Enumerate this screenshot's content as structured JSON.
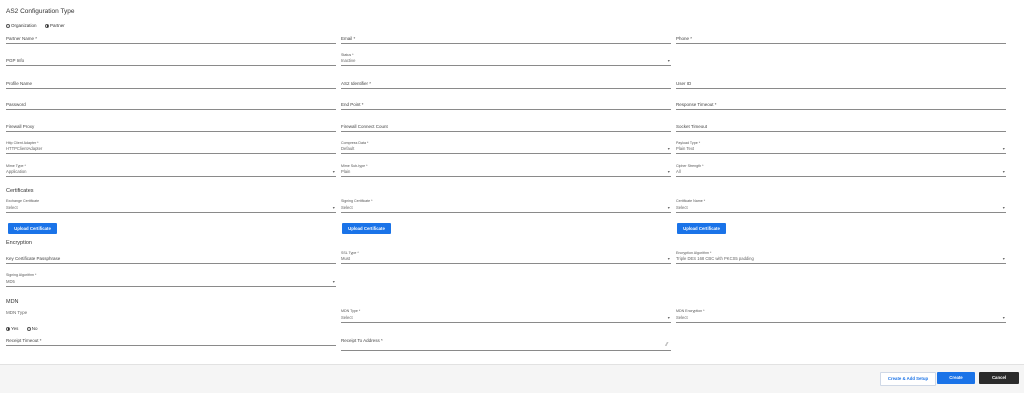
{
  "page": {
    "title": "AS2 Configuration Type",
    "config_type": {
      "options": [
        "Organization",
        "Partner"
      ],
      "selected": "Partner"
    }
  },
  "fields": {
    "partner_name": "Partner Name *",
    "email": "Email *",
    "phone": "Phone *",
    "pgp_info": "PGP Info",
    "status_label": "Status *",
    "status_value": "Inactive",
    "profile_name": "Profile Name",
    "as2_identifier": "AS2 Identifier *",
    "user_id": "User ID",
    "password": "Password",
    "end_point": "End Point *",
    "response_timeout": "Response Timeout *",
    "firewall_proxy": "Firewall Proxy",
    "firewall_connect_count": "Firewall Connect Count",
    "socket_timeout": "Socket Timeout",
    "http_client_adapter_label": "Http Client Adapter *",
    "http_client_adapter_value": "HTTPClientAdapter",
    "compress_data_label": "Compress Data *",
    "compress_data_value": "Default",
    "payload_type_label": "Payload Type *",
    "payload_type_value": "Plain Text",
    "mime_type_label": "Mime Type *",
    "mime_type_value": "Application",
    "mime_subtype_label": "Mime Sub-type *",
    "mime_subtype_value": "Plain",
    "cipher_strength_label": "Cipher Strength *",
    "cipher_strength_value": "All"
  },
  "certificates": {
    "heading": "Certificates",
    "exchange_label": "Exchange Certificate",
    "exchange_value": "Select",
    "signing_label": "Signing Certificate *",
    "signing_value": "Select",
    "cert_name_label": "Certificate Name *",
    "cert_name_value": "Select",
    "upload_label": "Upload Certificate"
  },
  "encryption": {
    "heading": "Encryption",
    "key_passphrase": "Key Certificate Passphrase",
    "ssl_type_label": "SSL Type *",
    "ssl_type_value": "Must",
    "enc_algo_label": "Encryption Algorithm *",
    "enc_algo_value": "Triple DES 168 CBC with PKCS5 padding",
    "sign_algo_label": "Signing Algorithm *",
    "sign_algo_value": "MD5"
  },
  "mdn": {
    "heading": "MDN",
    "mdn_type_label": "MDN Type",
    "options": [
      "Yes",
      "No"
    ],
    "selected": "Yes",
    "mdn_type2_label": "MDN Type *",
    "mdn_type2_value": "Select",
    "mdn_enc_label": "MDN Encryption *",
    "mdn_enc_value": "Select",
    "receipt_timeout": "Receipt Timeout *",
    "receipt_to_address": "Receipt To Address *"
  },
  "footer": {
    "create_add_setup": "Create & Add Setup",
    "create": "Create",
    "cancel": "Cancel"
  },
  "colors": {
    "primary": "#1a73e8",
    "cancel": "#2b2b2b"
  }
}
